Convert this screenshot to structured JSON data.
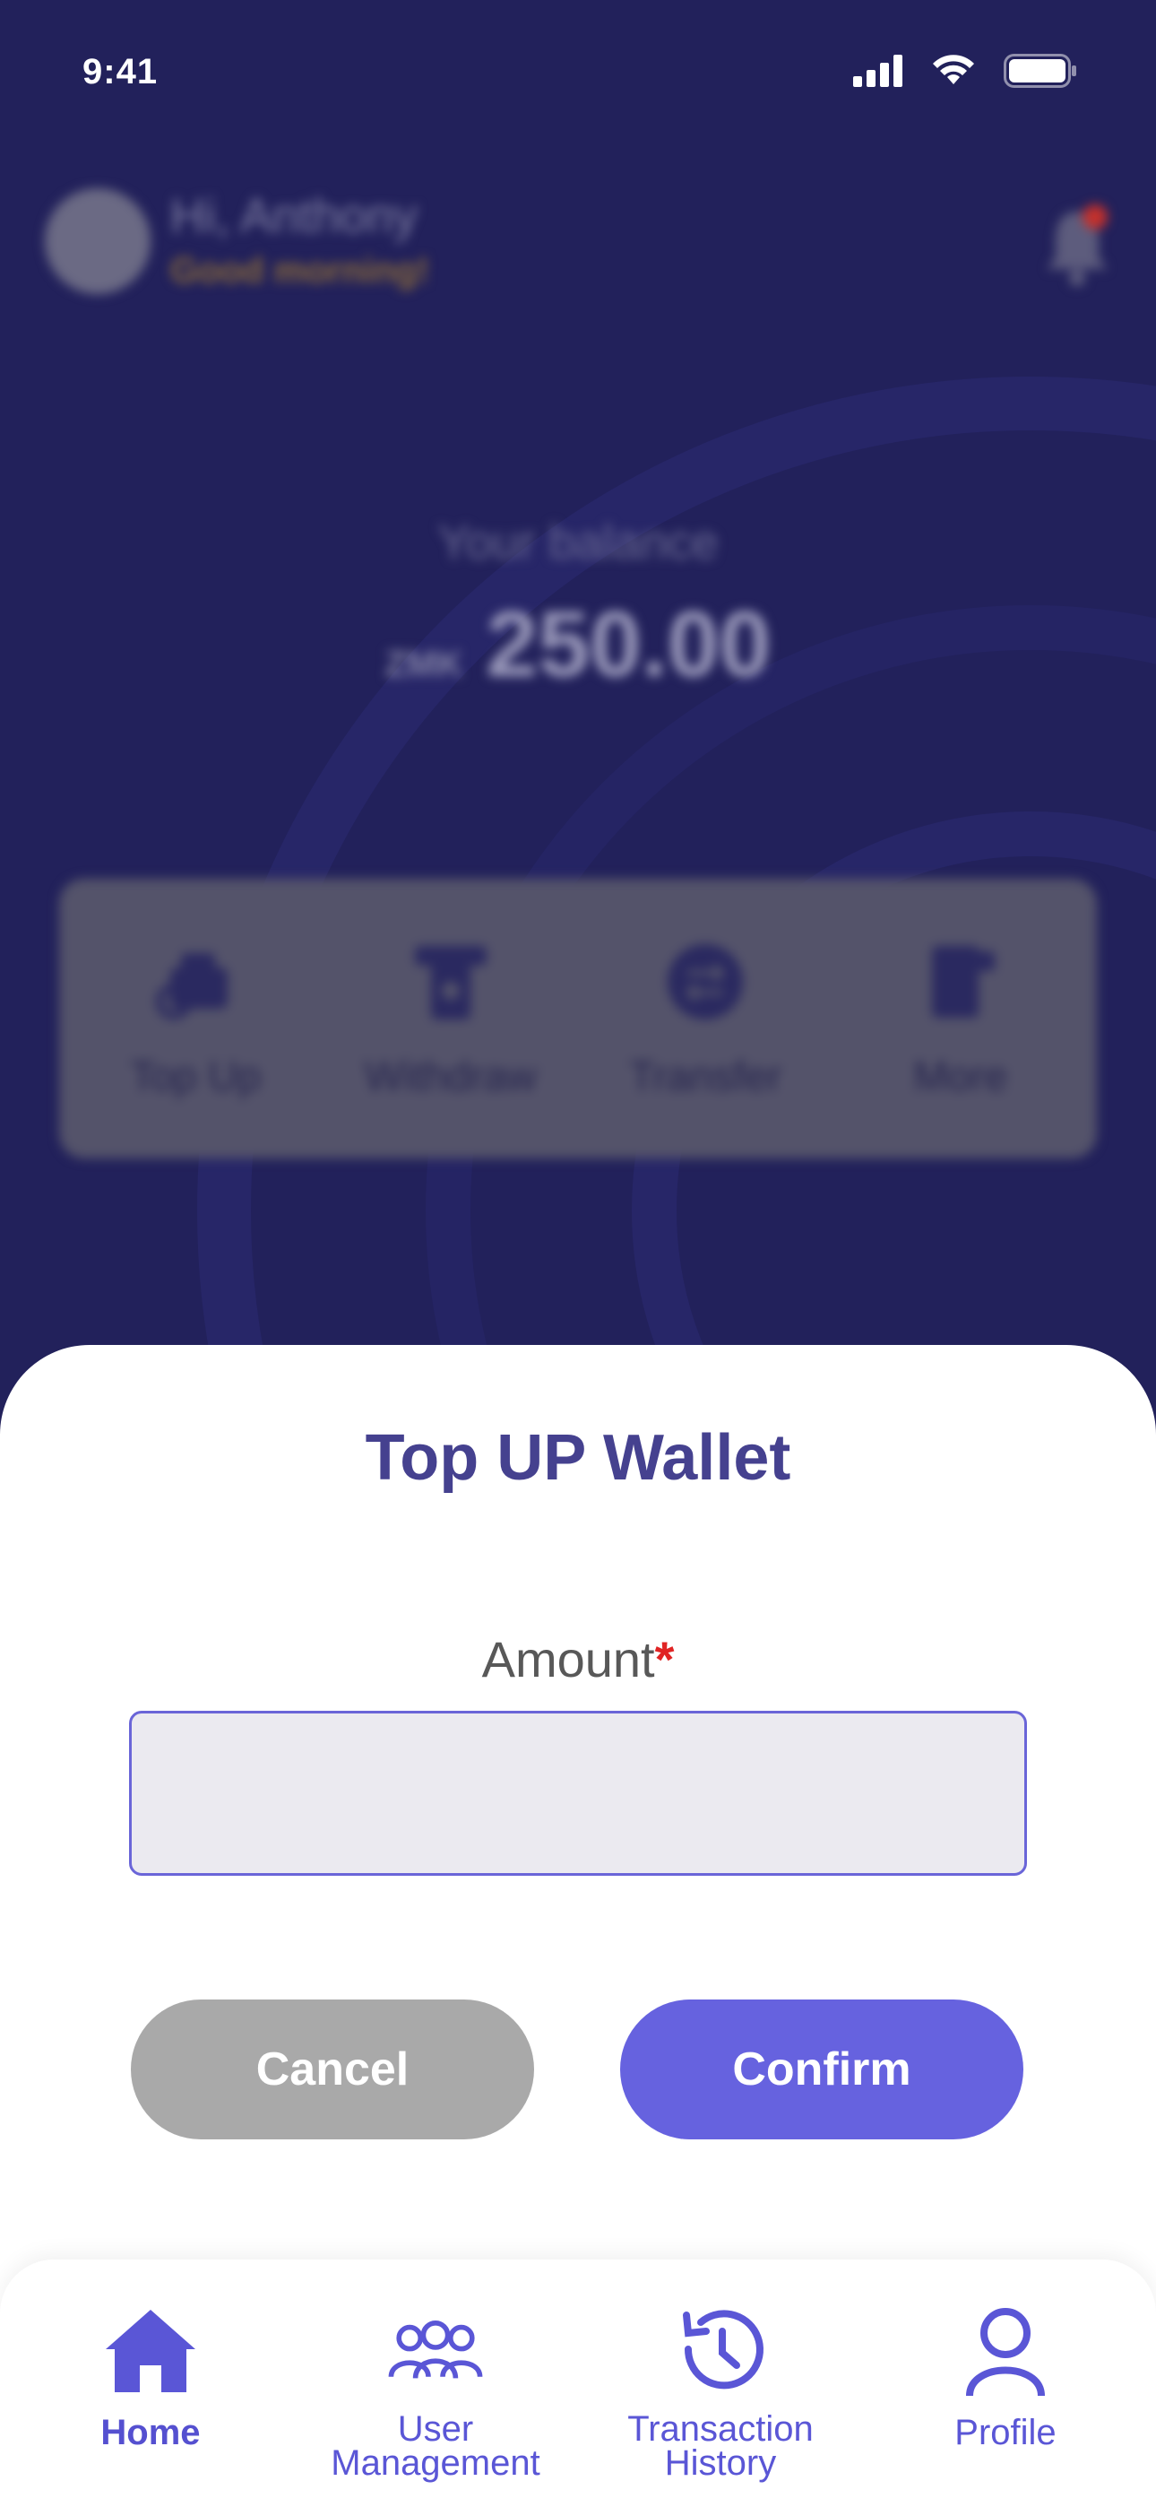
{
  "status_bar": {
    "time": "9:41"
  },
  "header": {
    "greeting": "Hi, Anthony",
    "subtitle": "Good morning!"
  },
  "balance": {
    "label": "Your balance",
    "currency": "ZMK",
    "amount": "250.00"
  },
  "actions": [
    {
      "label": "Top Up",
      "icon": "wallet-icon"
    },
    {
      "label": "Withdraw",
      "icon": "atm-icon"
    },
    {
      "label": "Transfer",
      "icon": "transfer-icon"
    },
    {
      "label": "More",
      "icon": "more-icon"
    }
  ],
  "sheet": {
    "title": "Top UP Wallet",
    "amount_label": "Amount",
    "required_mark": "*",
    "amount_value": "",
    "amount_placeholder": "",
    "cancel_label": "Cancel",
    "confirm_label": "Confirm"
  },
  "nav": {
    "home": "Home",
    "user_mgmt_line1": "User",
    "user_mgmt_line2": "Management",
    "history_line1": "Transaction",
    "history_line2": "History",
    "profile": "Profile"
  },
  "colors": {
    "accent": "#6662df",
    "title": "#45418f",
    "background": "#22215b",
    "cancel": "#a9a9a9",
    "required": "#e02424"
  }
}
